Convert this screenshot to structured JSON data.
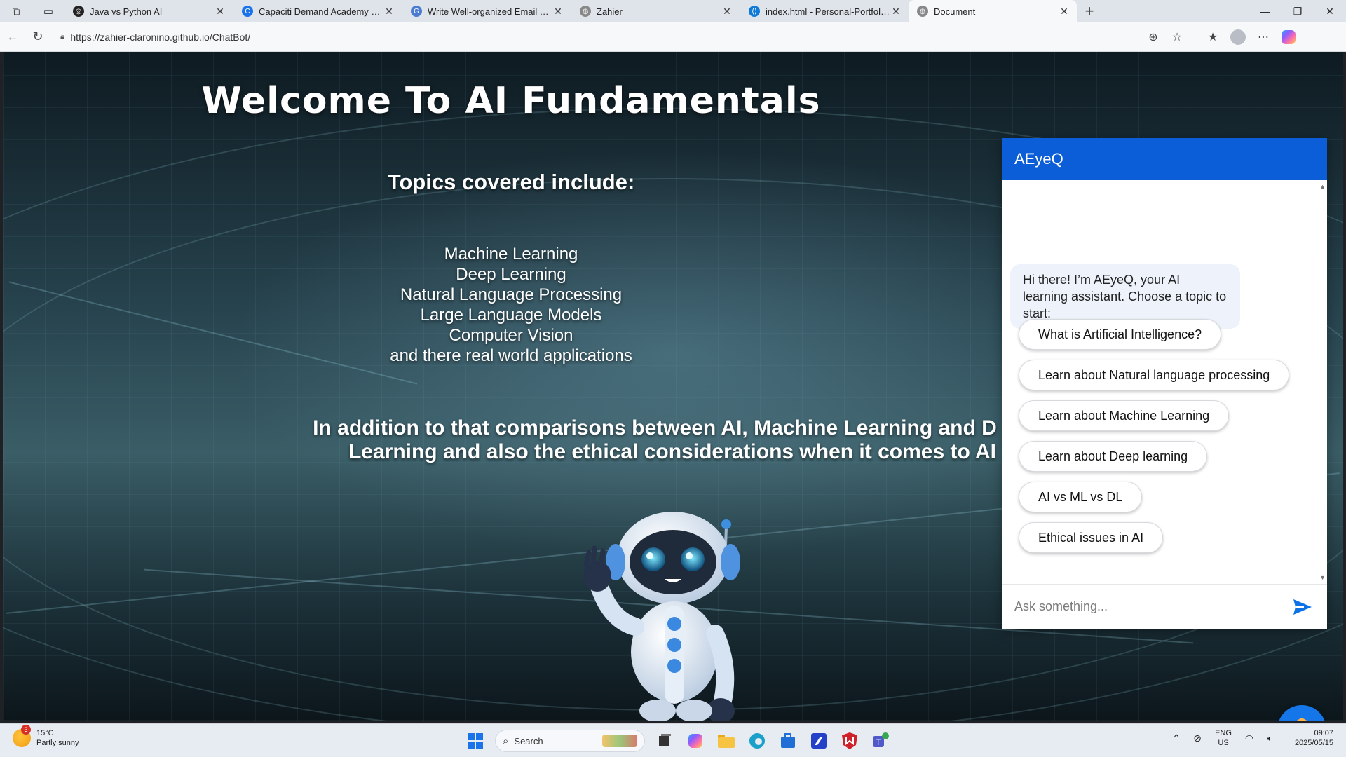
{
  "browser": {
    "tabs": [
      {
        "title": "Java vs Python AI",
        "favicon_color": "#222222"
      },
      {
        "title": "Capaciti Demand Academy 2|| CP",
        "favicon_color": "#1a73e8"
      },
      {
        "title": "Write Well-organized Email Text |",
        "favicon_color": "#4a7bd1"
      },
      {
        "title": "Zahier",
        "favicon_color": "#555555"
      },
      {
        "title": "index.html - Personal-Portfolio [G",
        "favicon_color": "#0f7ad8"
      },
      {
        "title": "Document",
        "favicon_color": "#555555"
      }
    ],
    "url": "https://zahier-claronino.github.io/ChatBot/"
  },
  "page": {
    "title": "Welcome To AI Fundamentals",
    "topics_heading": "Topics covered include:",
    "topics": [
      "Machine Learning",
      "Deep Learning",
      "Natural Language Processing",
      "Large Language Models",
      "Computer Vision",
      "and there real world applications"
    ],
    "addition_line1": "In addition to that comparisons between AI, Machine Learning and D",
    "addition_line2": "Learning and also the ethical considerations when it comes to AI"
  },
  "chatbot": {
    "name": "AEyeQ",
    "greeting": "Hi there! I’m AEyeQ, your AI learning assistant. Choose a topic to start:",
    "options": [
      "What is Artificial Intelligence?",
      "Learn about Natural language processing",
      "Learn about Machine Learning",
      "Learn about Deep learning",
      "AI vs ML vs DL",
      "Ethical issues in AI"
    ],
    "input_placeholder": "Ask something...",
    "header_color": "#0b5ed7"
  },
  "taskbar": {
    "weather_temp": "15°C",
    "weather_desc": "Partly sunny",
    "weather_badge": "3",
    "search_placeholder": "Search",
    "lang_line1": "ENG",
    "lang_line2": "US",
    "time": "09:07",
    "date": "2025/05/15"
  }
}
